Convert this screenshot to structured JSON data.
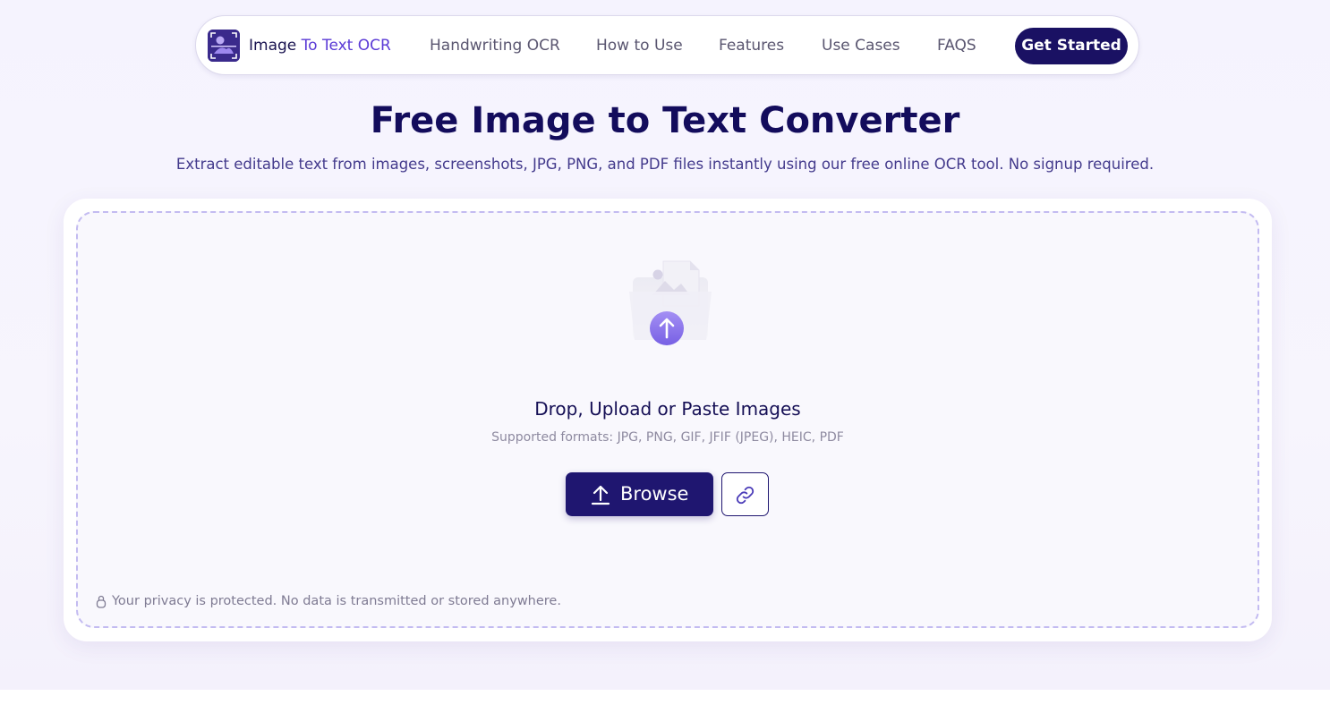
{
  "nav": {
    "brand_part1": "Image",
    "brand_part2": "To Text OCR",
    "links": [
      "Handwriting OCR",
      "How to Use",
      "Features",
      "Use Cases",
      "FAQS"
    ],
    "cta": "Get Started"
  },
  "hero": {
    "title": "Free Image to Text Converter",
    "subtitle": "Extract editable text from images, screenshots, JPG, PNG, and PDF files instantly using our free online OCR tool. No signup required."
  },
  "upload": {
    "illustration_icon": "image-upload-folder-icon",
    "title": "Drop, Upload or Paste Images",
    "formats": "Supported formats: JPG, PNG, GIF, JFIF (JPEG), HEIC, PDF",
    "browse_label": "Browse",
    "browse_icon": "upload-arrow-icon",
    "link_icon": "link-icon",
    "privacy_icon": "lock-icon",
    "privacy": "Your privacy is protected. No data is transmitted or stored anywhere."
  },
  "colors": {
    "primary": "#1a1163",
    "accent": "#5b3bd6",
    "dashed_border": "#c3bbf1"
  }
}
